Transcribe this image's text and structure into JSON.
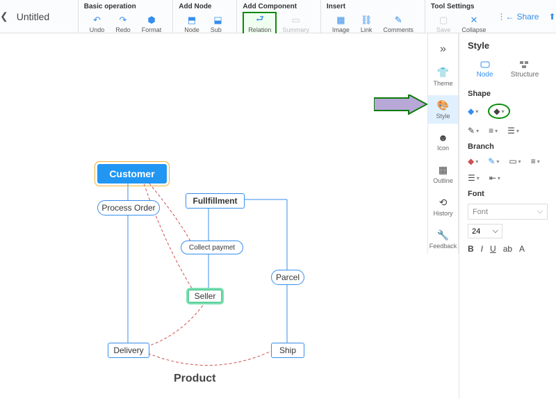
{
  "doc": {
    "title": "Untitled"
  },
  "toolbar": {
    "groups": {
      "basic": {
        "label": "Basic operation",
        "undo": "Undo",
        "redo": "Redo",
        "format_painter": "Format Painter"
      },
      "add_node": {
        "label": "Add Node",
        "node": "Node",
        "sub_node": "Sub Node"
      },
      "add_component": {
        "label": "Add Component",
        "relation": "Relation",
        "summary": "Summary"
      },
      "insert": {
        "label": "Insert",
        "image": "Image",
        "link": "Link",
        "comments": "Comments"
      },
      "tool_settings": {
        "label": "Tool Settings",
        "save": "Save",
        "collapse": "Collapse"
      }
    },
    "right": {
      "share": "Share",
      "export": "Export"
    }
  },
  "canvas": {
    "nodes": {
      "customer": "Customer",
      "process_order": "Process Order",
      "fullfillment": "Fullfillment",
      "collect_paymet": "Collect paymet",
      "seller": "Seller",
      "parcel": "Parcel",
      "delivery": "Delivery",
      "ship": "Ship",
      "product": "Product"
    }
  },
  "rail": {
    "theme": "Theme",
    "style": "Style",
    "icon": "Icon",
    "outline": "Outline",
    "history": "History",
    "feedback": "Feedback"
  },
  "panel": {
    "title": "Style",
    "tabs": {
      "node": "Node",
      "structure": "Structure"
    },
    "sections": {
      "shape": "Shape",
      "branch": "Branch",
      "font": "Font"
    },
    "font_placeholder": "Font",
    "font_size": "24",
    "bold": "B",
    "italic": "I",
    "underline": "U",
    "ab": "ab",
    "color": "A"
  }
}
